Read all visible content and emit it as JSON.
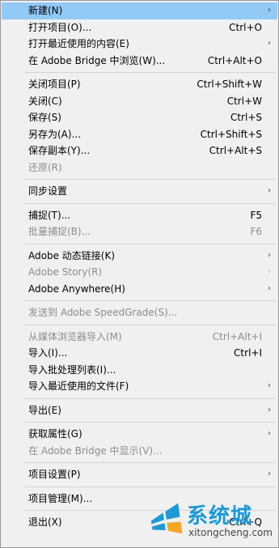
{
  "menu": {
    "groups": [
      [
        {
          "label": "新建(N)",
          "shortcut": "",
          "submenu": true,
          "disabled": false,
          "highlight": true,
          "icon": "submenu-arrow-icon"
        },
        {
          "label": "打开项目(O)...",
          "shortcut": "Ctrl+O",
          "submenu": false,
          "disabled": false
        },
        {
          "label": "打开最近使用的内容(E)",
          "shortcut": "",
          "submenu": true,
          "disabled": false,
          "icon": "submenu-arrow-icon"
        },
        {
          "label": "在 Adobe Bridge 中浏览(W)...",
          "shortcut": "Ctrl+Alt+O",
          "submenu": false,
          "disabled": false
        }
      ],
      [
        {
          "label": "关闭项目(P)",
          "shortcut": "Ctrl+Shift+W",
          "submenu": false,
          "disabled": false
        },
        {
          "label": "关闭(C)",
          "shortcut": "Ctrl+W",
          "submenu": false,
          "disabled": false
        },
        {
          "label": "保存(S)",
          "shortcut": "Ctrl+S",
          "submenu": false,
          "disabled": false
        },
        {
          "label": "另存为(A)...",
          "shortcut": "Ctrl+Shift+S",
          "submenu": false,
          "disabled": false
        },
        {
          "label": "保存副本(Y)...",
          "shortcut": "Ctrl+Alt+S",
          "submenu": false,
          "disabled": false
        },
        {
          "label": "还原(R)",
          "shortcut": "",
          "submenu": false,
          "disabled": true
        }
      ],
      [
        {
          "label": "同步设置",
          "shortcut": "",
          "submenu": true,
          "disabled": false,
          "icon": "submenu-arrow-icon"
        }
      ],
      [
        {
          "label": "捕捉(T)...",
          "shortcut": "F5",
          "submenu": false,
          "disabled": false
        },
        {
          "label": "批量捕捉(B)...",
          "shortcut": "F6",
          "submenu": false,
          "disabled": true
        }
      ],
      [
        {
          "label": "Adobe 动态链接(K)",
          "shortcut": "",
          "submenu": true,
          "disabled": false,
          "icon": "submenu-arrow-icon"
        },
        {
          "label": "Adobe Story(R)",
          "shortcut": "",
          "submenu": true,
          "disabled": true,
          "icon": "submenu-arrow-icon"
        },
        {
          "label": "Adobe Anywhere(H)",
          "shortcut": "",
          "submenu": true,
          "disabled": false,
          "icon": "submenu-arrow-icon"
        }
      ],
      [
        {
          "label": "发送到 Adobe SpeedGrade(S)...",
          "shortcut": "",
          "submenu": false,
          "disabled": true
        }
      ],
      [
        {
          "label": "从媒体浏览器导入(M)",
          "shortcut": "Ctrl+Alt+I",
          "submenu": false,
          "disabled": true
        },
        {
          "label": "导入(I)...",
          "shortcut": "Ctrl+I",
          "submenu": false,
          "disabled": false
        },
        {
          "label": "导入批处理列表(I)...",
          "shortcut": "",
          "submenu": false,
          "disabled": false
        },
        {
          "label": "导入最近使用的文件(F)",
          "shortcut": "",
          "submenu": true,
          "disabled": false,
          "icon": "submenu-arrow-icon"
        }
      ],
      [
        {
          "label": "导出(E)",
          "shortcut": "",
          "submenu": true,
          "disabled": false,
          "icon": "submenu-arrow-icon"
        }
      ],
      [
        {
          "label": "获取属性(G)",
          "shortcut": "",
          "submenu": true,
          "disabled": false,
          "icon": "submenu-arrow-icon"
        },
        {
          "label": "在 Adobe Bridge 中显示(V)...",
          "shortcut": "",
          "submenu": false,
          "disabled": true
        }
      ],
      [
        {
          "label": "项目设置(P)",
          "shortcut": "",
          "submenu": true,
          "disabled": false,
          "icon": "submenu-arrow-icon"
        }
      ],
      [
        {
          "label": "项目管理(M)...",
          "shortcut": "",
          "submenu": false,
          "disabled": false
        }
      ],
      [
        {
          "label": "退出(X)",
          "shortcut": "Ctrl+Q",
          "submenu": false,
          "disabled": false
        }
      ]
    ],
    "submenu_glyph": "›"
  },
  "watermark": {
    "text": "系统城",
    "url": "xitongcheng.com",
    "icon": "windows-logo-icon",
    "colors": {
      "blue": "#1b9ad6",
      "accent": "#f5a623"
    }
  },
  "colors": {
    "highlight": "#91c9f7",
    "background": "#f0f0f0",
    "disabled_text": "#8d8d8d",
    "separator": "#d4d4d4"
  }
}
